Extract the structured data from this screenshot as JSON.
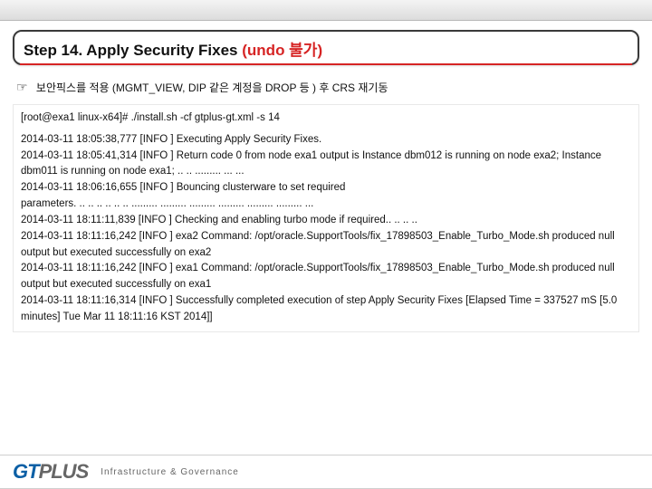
{
  "title": {
    "main": "Step 14. Apply Security Fixes ",
    "suffix": "(undo 불가)"
  },
  "bullet": {
    "icon": "☞",
    "text": "보안픽스를 적용 (MGMT_VIEW, DIP 같은 계정을 DROP 등 ) 후 CRS 재기동"
  },
  "terminal": {
    "lines": [
      "[root@exa1 linux-x64]# ./install.sh -cf gtplus-gt.xml -s 14",
      "",
      "2014-03-11 18:05:38,777 [INFO ] Executing Apply Security Fixes.",
      "2014-03-11 18:05:41,314 [INFO ] Return code 0 from node exa1 output is Instance dbm012 is running on node exa2; Instance dbm011 is running on node exa1; .. .. ......... ... ...",
      "2014-03-11 18:06:16,655 [INFO ] Bouncing clusterware to set required",
      "parameters. .. .. .. .. .. .. ......... ......... ......... ......... ......... ......... ...",
      "2014-03-11 18:11:11,839 [INFO ] Checking and enabling turbo mode if required.. .. .. ..",
      "2014-03-11 18:11:16,242 [INFO ] exa2 Command: /opt/oracle.SupportTools/fix_17898503_Enable_Turbo_Mode.sh produced null output but executed successfully on exa2",
      "2014-03-11 18:11:16,242 [INFO ] exa1 Command: /opt/oracle.SupportTools/fix_17898503_Enable_Turbo_Mode.sh produced null output but executed successfully on exa1",
      "2014-03-11 18:11:16,314 [INFO ] Successfully completed execution of step Apply Security Fixes [Elapsed Time = 337527 mS [5.0 minutes] Tue Mar 11 18:11:16 KST 2014]]"
    ]
  },
  "footer": {
    "logo_main": "GT",
    "logo_sub": "PLUS",
    "tagline": "Infrastructure & Governance"
  }
}
